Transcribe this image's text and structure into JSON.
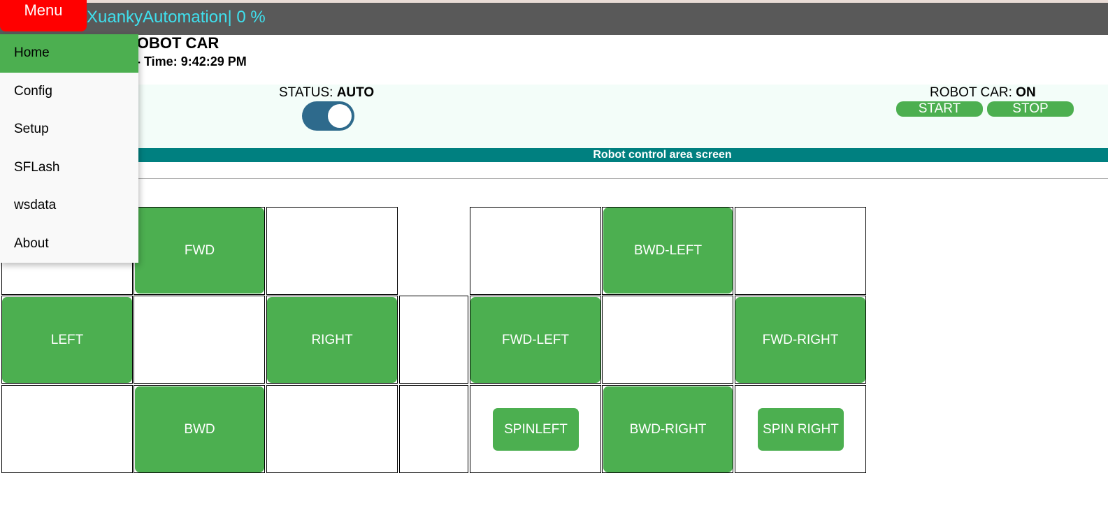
{
  "navbar": {
    "menu_label": "Menu",
    "app_title": "XuankyAutomation| 0 %"
  },
  "header": {
    "title": "ROBOT CAR",
    "date_time": "4 - Time: 9:42:29 PM"
  },
  "status": {
    "label": "STATUS: ",
    "value": "AUTO",
    "toggle_on": true
  },
  "robot_car": {
    "label": "ROBOT CAR: ",
    "value": "ON",
    "start_label": "START",
    "stop_label": "STOP"
  },
  "area_bar": {
    "label": "Robot control area screen"
  },
  "controls": {
    "fwd": "FWD",
    "left": "LEFT",
    "right": "RIGHT",
    "bwd": "BWD",
    "bwd_left": "BWD-LEFT",
    "fwd_left": "FWD-LEFT",
    "fwd_right": "FWD-RIGHT",
    "spin_left": "SPINLEFT",
    "bwd_right": "BWD-RIGHT",
    "spin_right": "SPIN RIGHT"
  },
  "side_menu": {
    "items": [
      {
        "label": "Home",
        "active": true
      },
      {
        "label": "Config"
      },
      {
        "label": "Setup"
      },
      {
        "label": "SFLash"
      },
      {
        "label": "wsdata"
      },
      {
        "label": "About"
      }
    ]
  },
  "colors": {
    "navbar": "#595959",
    "menu_button": "#ff0000",
    "accent_green": "#4caf50",
    "area_bar": "#008080",
    "toggle": "#2e6a8c",
    "title_cyan": "#3fe0ee"
  }
}
